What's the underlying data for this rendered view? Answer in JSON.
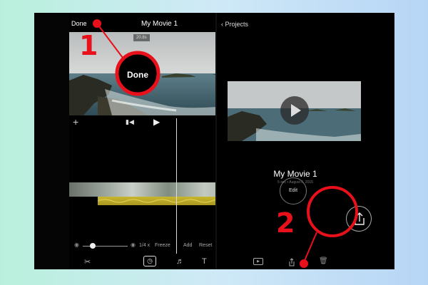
{
  "editor": {
    "done_label": "Done",
    "title": "My Movie 1",
    "help_icon": "?",
    "timecode": "20.8s",
    "speed_value": "1/4 x",
    "freeze_label": "Freeze",
    "add_label": "Add",
    "reset_label": "Reset"
  },
  "callouts": {
    "done_zoom_label": "Done",
    "step1": "1",
    "step2": "2"
  },
  "projects": {
    "back_label": "Projects",
    "movie_title": "My Movie 1",
    "movie_meta": "5 sec • August 6, 2015",
    "edit_label": "Edit"
  },
  "colors": {
    "annotation_red": "#e8101a",
    "audio_clip": "#c8b62e",
    "background_left": "#b9f0dc",
    "background_right": "#b7d5f5"
  }
}
